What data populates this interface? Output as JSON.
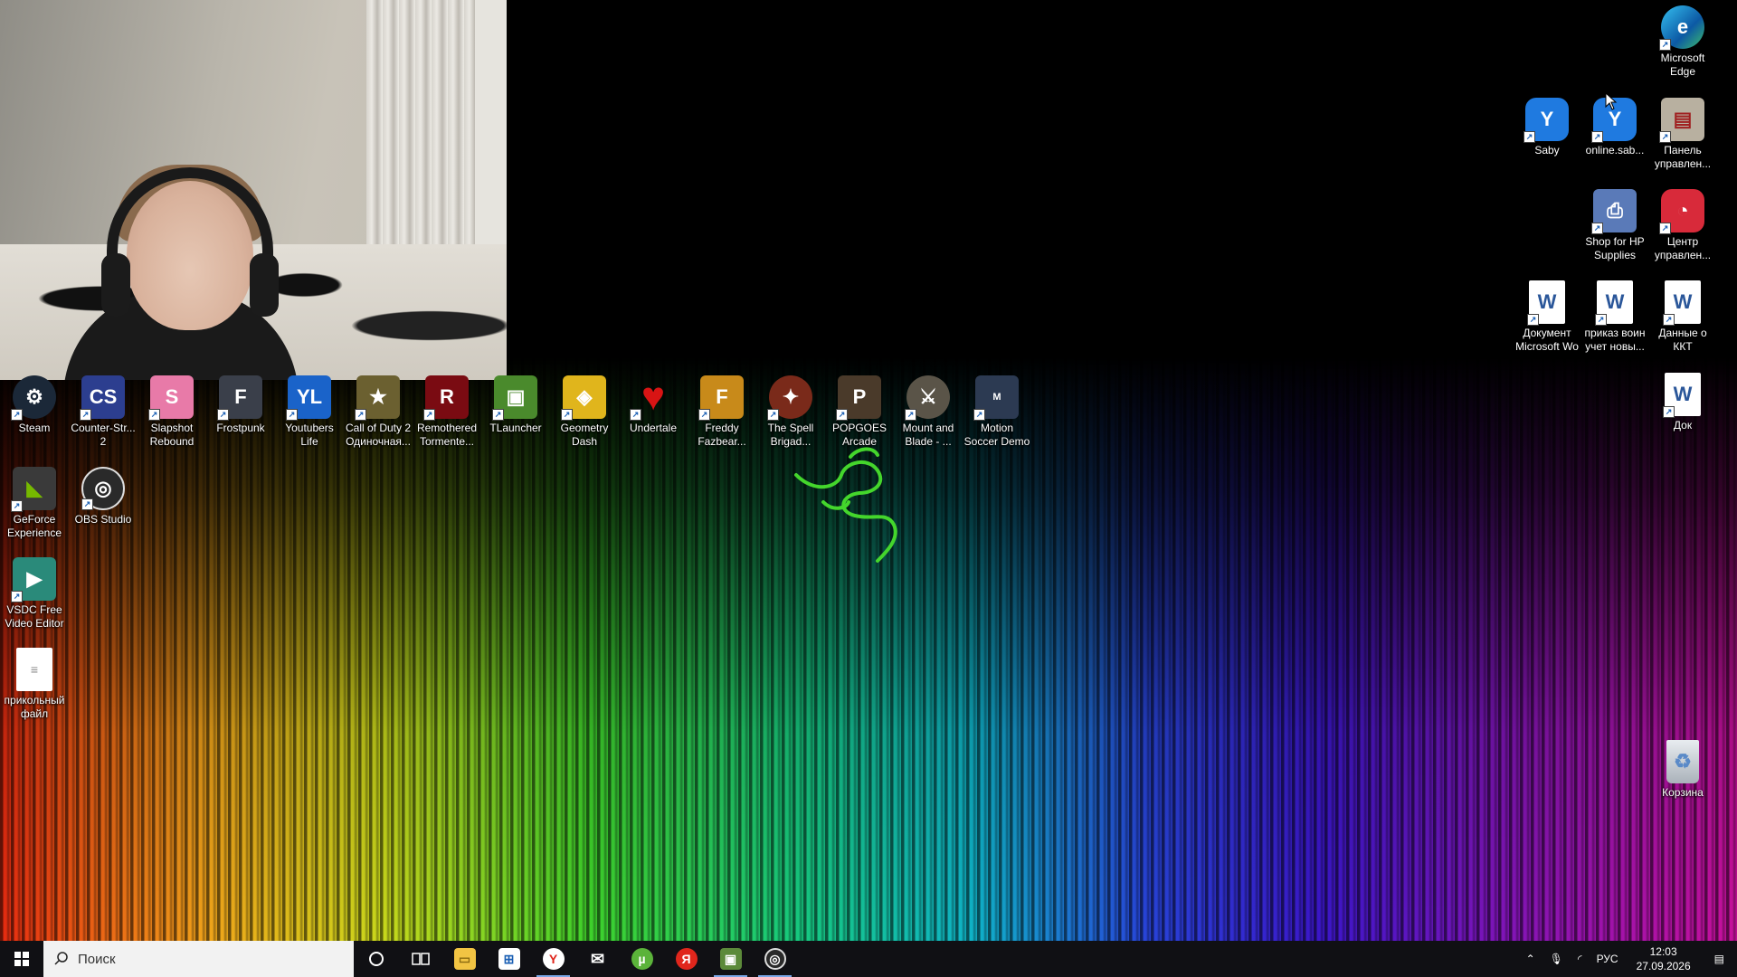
{
  "desktop_icons_left": [
    {
      "label": "Steam",
      "icon": "steam-icon",
      "color": "#1b2838"
    },
    {
      "label": "Counter-Str...\n2",
      "icon": "cs2-icon",
      "color": "#2c3e8f"
    },
    {
      "label": "Slapshot\nRebound",
      "icon": "slapshot-icon",
      "color": "#e87aa8"
    },
    {
      "label": "Frostpunk",
      "icon": "frostpunk-icon",
      "color": "#3a3f4a"
    },
    {
      "label": "Youtubers\nLife",
      "icon": "youtubers-life-icon",
      "color": "#1a63c9"
    },
    {
      "label": "Call of Duty 2\nОдиночная...",
      "icon": "call-of-duty-icon",
      "color": "#6b6030"
    },
    {
      "label": "Remothered\nTormente...",
      "icon": "remothered-icon",
      "color": "#7a0b12"
    },
    {
      "label": "TLauncher",
      "icon": "tlauncher-icon",
      "color": "#4a8a2c"
    },
    {
      "label": "Geometry\nDash",
      "icon": "geometry-dash-icon",
      "color": "#e0b51c"
    },
    {
      "label": "Undertale",
      "icon": "undertale-icon",
      "color": "#d81414"
    },
    {
      "label": "Freddy\nFazbear...",
      "icon": "freddy-icon",
      "color": "#c88a1a"
    },
    {
      "label": "The Spell\nBrigad...",
      "icon": "spell-brigade-icon",
      "color": "#7a2a1a"
    },
    {
      "label": "POPGOES\nArcade",
      "icon": "popgoes-icon",
      "color": "#4a3a2a"
    },
    {
      "label": "Mount and\nBlade - ...",
      "icon": "mount-blade-icon",
      "color": "#5a5448"
    },
    {
      "label": "Motion\nSoccer Demo",
      "icon": "motion-soccer-icon",
      "color": "#2c3a52"
    },
    {
      "label": "GeForce\nExperience",
      "icon": "geforce-icon",
      "color": "#3a3a3a"
    },
    {
      "label": "OBS Studio",
      "icon": "obs-icon",
      "color": "#2a2a2a"
    },
    {
      "label": "VSDC Free\nVideo Editor",
      "icon": "vsdc-icon",
      "color": "#2a8a7a"
    },
    {
      "label": "прикольный\nфайл",
      "icon": "text-file-icon",
      "color": "#ffffff"
    }
  ],
  "desktop_icons_right": [
    {
      "label": "Microsoft\nEdge",
      "icon": "edge-icon",
      "color": "#1e8fd8"
    },
    {
      "label": "Saby",
      "icon": "saby-icon",
      "color": "#1f7ae0"
    },
    {
      "label": "online.sab...",
      "icon": "saby-online-icon",
      "color": "#1f7ae0"
    },
    {
      "label": "Панель\nуправлен...",
      "icon": "control-panel-icon",
      "color": "#b8b0a0"
    },
    {
      "label": "Shop for HP\nSupplies",
      "icon": "hp-shop-icon",
      "color": "#5a7ab8"
    },
    {
      "label": "Центр\nуправлен...",
      "icon": "control-center-icon",
      "color": "#d82a3a"
    },
    {
      "label": "Документ\nMicrosoft Wo",
      "icon": "word-doc-icon",
      "color": "#2b579a"
    },
    {
      "label": "приказ воин\nучет новы...",
      "icon": "word-doc-icon",
      "color": "#2b579a"
    },
    {
      "label": "Данные о\nККТ",
      "icon": "word-doc-icon",
      "color": "#2b579a"
    },
    {
      "label": "Док",
      "icon": "word-doc-icon",
      "color": "#2b579a"
    },
    {
      "label": "Корзина",
      "icon": "recycle-bin-icon",
      "color": "#c8ccd0"
    }
  ],
  "taskbar": {
    "search_placeholder": "Поиск",
    "apps": [
      {
        "name": "cortana-icon"
      },
      {
        "name": "task-view-icon"
      },
      {
        "name": "file-explorer-icon"
      },
      {
        "name": "store-icon"
      },
      {
        "name": "yandex-browser-icon",
        "active": true
      },
      {
        "name": "mail-icon"
      },
      {
        "name": "utorrent-icon"
      },
      {
        "name": "yandex-icon"
      },
      {
        "name": "minecraft-icon",
        "active": true
      },
      {
        "name": "obs-icon",
        "active": true
      }
    ],
    "tray": {
      "language": "РУС",
      "time": "12:03",
      "date": "27.09.2026"
    }
  },
  "colors": {
    "taskbar_bg": "#101014",
    "search_bg": "#f2f2f2",
    "razer_green": "#44d62c"
  }
}
